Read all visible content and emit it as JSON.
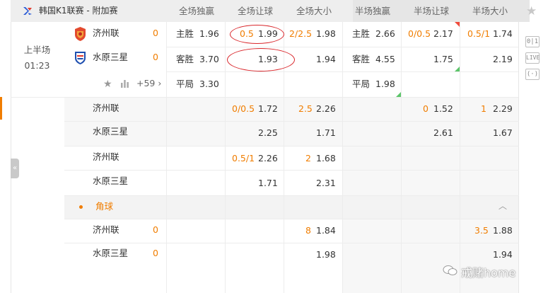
{
  "header": {
    "league": "韩国K1联赛 - 附加赛",
    "columns": [
      "全场独赢",
      "全场让球",
      "全场大小",
      "半场独赢",
      "半场让球",
      "半场大小"
    ]
  },
  "match": {
    "period": "上半场",
    "clock": "01:23",
    "home": {
      "name": "济州联",
      "score": "0"
    },
    "away": {
      "name": "水原三星",
      "score": "0"
    },
    "more_count": "+59 ›"
  },
  "main_odds": {
    "ft_1x2": [
      {
        "label": "主胜",
        "value": "1.96"
      },
      {
        "label": "客胜",
        "value": "3.70"
      },
      {
        "label": "平局",
        "value": "3.30"
      }
    ],
    "ft_hdp": {
      "line": "0.5",
      "home": "1.99",
      "away": "1.93"
    },
    "ft_ou": {
      "line": "2/2.5",
      "over": "1.98",
      "under": "1.94"
    },
    "ht_1x2": [
      {
        "label": "主胜",
        "value": "2.66"
      },
      {
        "label": "客胜",
        "value": "4.55"
      },
      {
        "label": "平局",
        "value": "1.98"
      }
    ],
    "ht_hdp": {
      "line": "0/0.5",
      "home": "2.17",
      "away": "1.75"
    },
    "ht_ou": {
      "line": "0.5/1",
      "over": "1.74",
      "under": "2.19"
    }
  },
  "alt_lines": [
    {
      "home": "济州联",
      "away": "水原三星",
      "ft_hdp": {
        "line": "0/0.5",
        "home": "1.72",
        "away": "2.25"
      },
      "ft_ou": {
        "line": "2.5",
        "over": "2.26",
        "under": "1.71"
      },
      "ht_hdp": {
        "line": "0",
        "home": "1.52",
        "away": "2.61"
      },
      "ht_ou": {
        "line": "1",
        "over": "2.29",
        "under": "1.67"
      }
    },
    {
      "home": "济州联",
      "away": "水原三星",
      "ft_hdp": {
        "line": "0.5/1",
        "home": "2.26",
        "away": "1.71"
      },
      "ft_ou": {
        "line": "2",
        "over": "1.68",
        "under": "2.31"
      }
    }
  ],
  "corners": {
    "title": "角球",
    "home": {
      "name": "济州联",
      "score": "0"
    },
    "away": {
      "name": "水原三星",
      "score": "0"
    },
    "ft_ou": {
      "line": "8",
      "over": "1.84",
      "under": "1.98"
    },
    "ht_ou": {
      "line": "3.5",
      "over": "1.88",
      "under": "1.94"
    }
  },
  "side_buttons": [
    "0|1",
    "LIVE",
    "(·)"
  ],
  "watermark": "戒赌home",
  "colors": {
    "accent": "#f07d00",
    "circle": "#d9262b",
    "up": "#5cc56a",
    "down": "#f04b3c"
  }
}
